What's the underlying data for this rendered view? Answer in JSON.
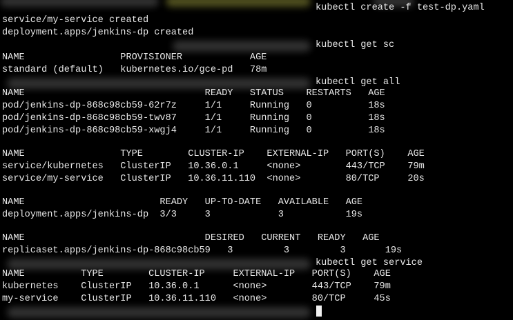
{
  "terminal": {
    "commands": {
      "create": "kubectl create -f test-dp.yaml",
      "get_sc": "kubectl get sc",
      "get_all": "kubectl get all",
      "get_service": "kubectl get service"
    },
    "output": {
      "create": [
        "service/my-service created",
        "deployment.apps/jenkins-dp created"
      ],
      "sc": [
        "NAME                 PROVISIONER            AGE",
        "standard (default)   kubernetes.io/gce-pd   78m"
      ],
      "pods": [
        "NAME                                READY   STATUS    RESTARTS   AGE",
        "pod/jenkins-dp-868c98cb59-62r7z     1/1     Running   0          18s",
        "pod/jenkins-dp-868c98cb59-twv87     1/1     Running   0          18s",
        "pod/jenkins-dp-868c98cb59-xwgj4     1/1     Running   0          18s"
      ],
      "services": [
        "NAME                 TYPE        CLUSTER-IP    EXTERNAL-IP   PORT(S)    AGE",
        "service/kubernetes   ClusterIP   10.36.0.1     <none>        443/TCP    79m",
        "service/my-service   ClusterIP   10.36.11.110  <none>        80/TCP     20s"
      ],
      "deployments": [
        "NAME                        READY   UP-TO-DATE   AVAILABLE   AGE",
        "deployment.apps/jenkins-dp  3/3     3            3           19s"
      ],
      "replicasets": [
        "NAME                                DESIRED   CURRENT   READY   AGE",
        "replicaset.apps/jenkins-dp-868c98cb59   3         3         3       19s"
      ],
      "get_service": [
        "NAME          TYPE        CLUSTER-IP     EXTERNAL-IP   PORT(S)    AGE",
        "kubernetes    ClusterIP   10.36.0.1      <none>        443/TCP    79m",
        "my-service    ClusterIP   10.36.11.110   <none>        80/TCP     45s"
      ]
    }
  }
}
